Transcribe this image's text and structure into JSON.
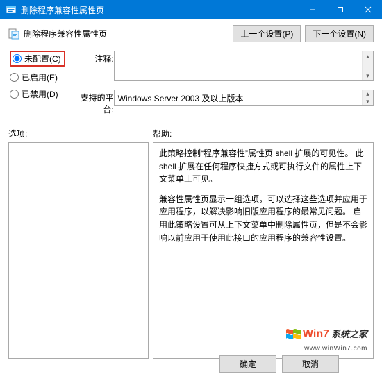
{
  "titlebar": {
    "title": "删除程序兼容性属性页"
  },
  "policy": {
    "title": "删除程序兼容性属性页"
  },
  "nav": {
    "prev": "上一个设置(P)",
    "next": "下一个设置(N)"
  },
  "radios": {
    "not_configured": "未配置(C)",
    "enabled": "已启用(E)",
    "disabled": "已禁用(D)"
  },
  "labels": {
    "comment": "注释:",
    "platform": "支持的平台:",
    "options": "选项:",
    "help": "帮助:"
  },
  "platform_value": "Windows Server 2003 及以上版本",
  "help_text": {
    "p1": "此策略控制“程序兼容性”属性页 shell 扩展的可见性。 此 shell 扩展在任何程序快捷方式或可执行文件的属性上下文菜单上可见。",
    "p2": "兼容性属性页显示一组选项，可以选择这些选项并应用于应用程序，以解决影响旧版应用程序的最常见问题。 启用此策略设置可从上下文菜单中删除属性页，但是不会影响以前应用于使用此接口的应用程序的兼容性设置。"
  },
  "footer": {
    "ok": "确定",
    "cancel": "取消"
  },
  "watermark": {
    "t1": "Win7",
    "t2": "系统之家",
    "sub": "www.winWin7.com"
  }
}
